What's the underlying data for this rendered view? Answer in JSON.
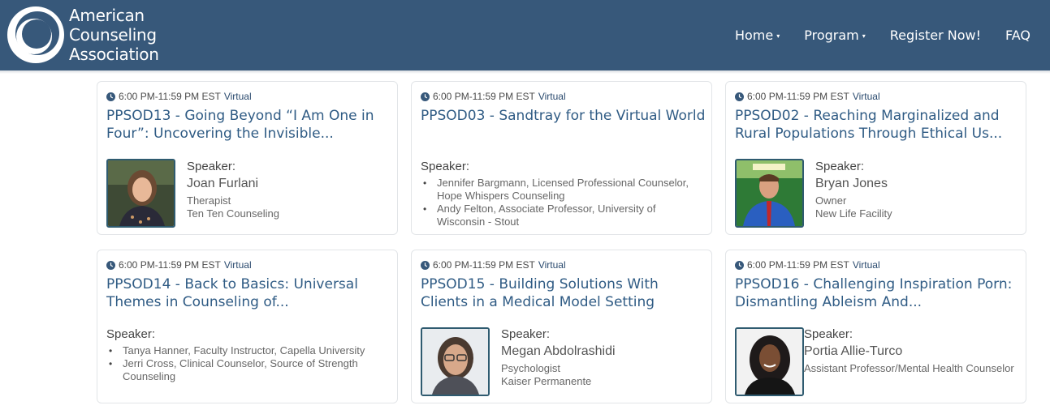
{
  "header": {
    "logo_lines": [
      "American",
      "Counseling",
      "Association"
    ],
    "nav": [
      {
        "label": "Home",
        "caret": true
      },
      {
        "label": "Program",
        "caret": true
      },
      {
        "label": "Register Now!",
        "caret": false
      },
      {
        "label": "FAQ",
        "caret": false
      }
    ],
    "colors": {
      "bar": "#37587a",
      "title": "#2f5b84"
    }
  },
  "sessions": [
    {
      "time": "6:00 PM-11:59 PM EST",
      "format": "Virtual",
      "title": "PPSOD13 - Going Beyond “I Am One in Four”: Uncovering the Invisible...",
      "speaker_label": "Speaker:",
      "speaker_name": "Joan Furlani",
      "speaker_role": "Therapist",
      "speaker_org": "Ten Ten Counseling"
    },
    {
      "time": "6:00 PM-11:59 PM EST",
      "format": "Virtual",
      "title": "PPSOD03 - Sandtray for the Virtual World",
      "speaker_label": "Speaker:",
      "speakers": [
        "Jennifer Bargmann, Licensed Professional Counselor, Hope Whispers Counseling",
        "Andy Felton, Associate Professor, University of Wisconsin - Stout"
      ]
    },
    {
      "time": "6:00 PM-11:59 PM EST",
      "format": "Virtual",
      "title": "PPSOD02 - Reaching Marginalized and Rural Populations Through Ethical Us...",
      "speaker_label": "Speaker:",
      "speaker_name": "Bryan Jones",
      "speaker_role": "Owner",
      "speaker_org": "New Life Facility"
    },
    {
      "time": "6:00 PM-11:59 PM EST",
      "format": "Virtual",
      "title": "PPSOD14 - Back to Basics: Universal Themes in Counseling of...",
      "speaker_label": "Speaker:",
      "speakers": [
        "Tanya Hanner, Faculty Instructor, Capella University",
        "Jerri Cross, Clinical Counselor, Source of Strength Counseling"
      ]
    },
    {
      "time": "6:00 PM-11:59 PM EST",
      "format": "Virtual",
      "title": "PPSOD15 - Building Solutions With Clients in a Medical Model Setting",
      "speaker_label": "Speaker:",
      "speaker_name": "Megan Abdolrashidi",
      "speaker_role": "Psychologist",
      "speaker_org": "Kaiser Permanente"
    },
    {
      "time": "6:00 PM-11:59 PM EST",
      "format": "Virtual",
      "title": "PPSOD16 - Challenging Inspiration Porn: Dismantling Ableism And...",
      "speaker_label": "Speaker:",
      "speaker_name": "Portia Allie-Turco",
      "speaker_role": "Assistant Professor/Mental Health Counselor"
    }
  ]
}
